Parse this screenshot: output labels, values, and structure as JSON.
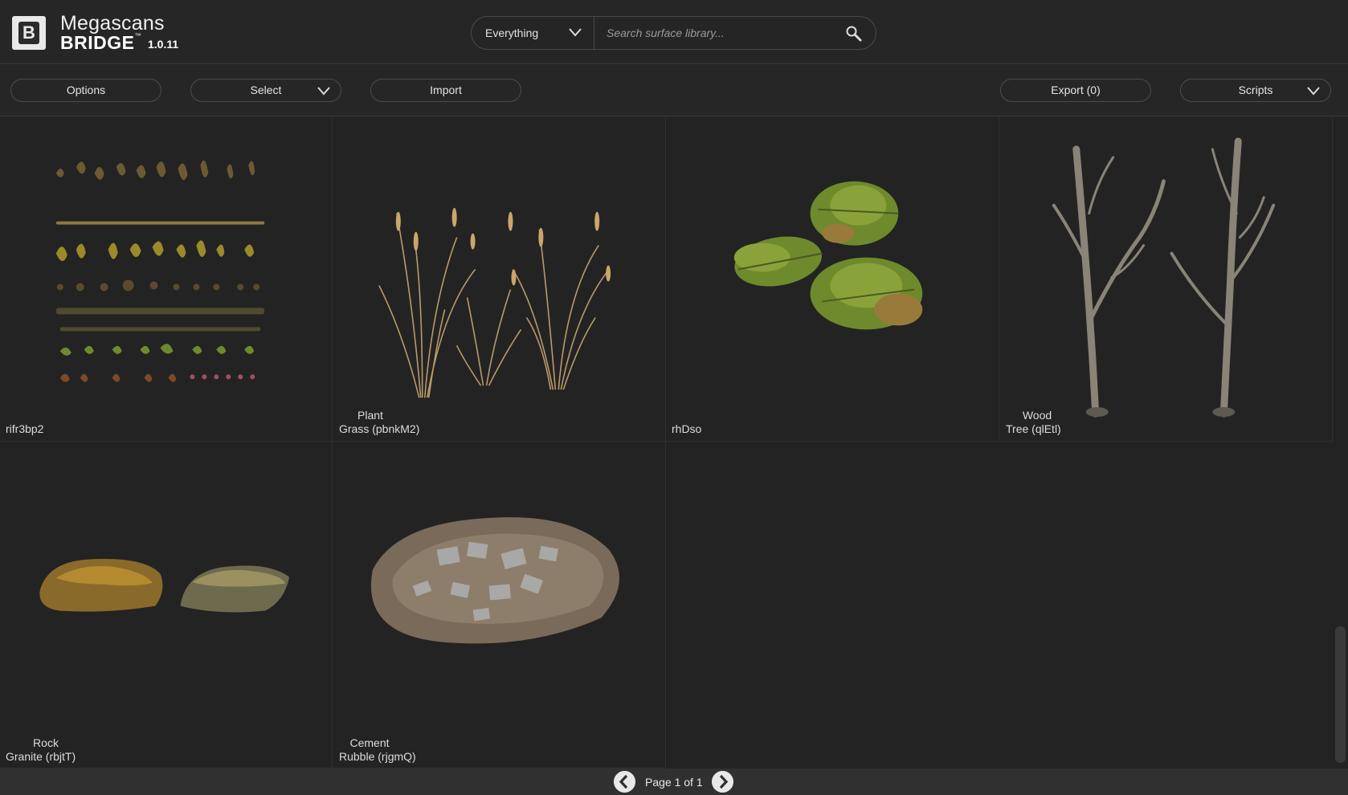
{
  "app": {
    "logo_letter": "B",
    "brand_name_top": "Megascans",
    "brand_name_bottom": "BRIDGE",
    "brand_tm": "™",
    "version": "1.0.11"
  },
  "search": {
    "filter_selected": "Everything",
    "placeholder": "Search surface library...",
    "value": ""
  },
  "toolbar": {
    "options_label": "Options",
    "select_label": "Select",
    "import_label": "Import",
    "export_label": "Export (0)",
    "scripts_label": "Scripts"
  },
  "assets": [
    {
      "category": "",
      "name": "rifr3bp2",
      "thumb": "leaf-atlas"
    },
    {
      "category": "Plant",
      "name": "Grass (pbnkM2)",
      "thumb": "grass"
    },
    {
      "category": "",
      "name": "rhDso",
      "thumb": "fern"
    },
    {
      "category": "Wood",
      "name": "Tree (qlEtl)",
      "thumb": "dead-trees"
    },
    {
      "category": "Rock",
      "name": "Granite (rbjtT)",
      "thumb": "rocks"
    },
    {
      "category": "Cement",
      "name": "Rubble (rjgmQ)",
      "thumb": "rubble"
    }
  ],
  "pagination": {
    "label": "Page 1 of 1",
    "current": 1,
    "total": 1
  },
  "colors": {
    "background": "#232323",
    "panel": "#262626",
    "border": "#4a4a4a",
    "text": "#e6e6e6"
  }
}
